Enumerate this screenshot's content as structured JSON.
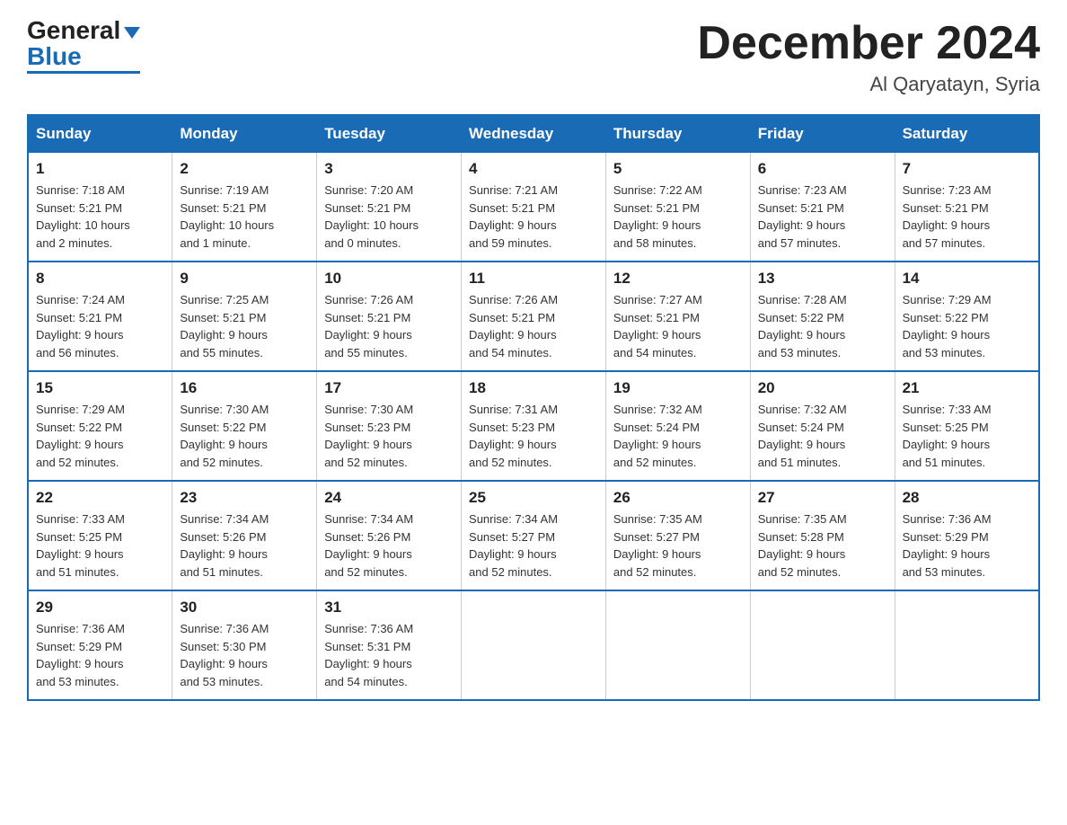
{
  "header": {
    "logo_general": "General",
    "logo_blue": "Blue",
    "month_title": "December 2024",
    "location": "Al Qaryatayn, Syria"
  },
  "weekdays": [
    "Sunday",
    "Monday",
    "Tuesday",
    "Wednesday",
    "Thursday",
    "Friday",
    "Saturday"
  ],
  "weeks": [
    [
      {
        "day": "1",
        "info": "Sunrise: 7:18 AM\nSunset: 5:21 PM\nDaylight: 10 hours\nand 2 minutes."
      },
      {
        "day": "2",
        "info": "Sunrise: 7:19 AM\nSunset: 5:21 PM\nDaylight: 10 hours\nand 1 minute."
      },
      {
        "day": "3",
        "info": "Sunrise: 7:20 AM\nSunset: 5:21 PM\nDaylight: 10 hours\nand 0 minutes."
      },
      {
        "day": "4",
        "info": "Sunrise: 7:21 AM\nSunset: 5:21 PM\nDaylight: 9 hours\nand 59 minutes."
      },
      {
        "day": "5",
        "info": "Sunrise: 7:22 AM\nSunset: 5:21 PM\nDaylight: 9 hours\nand 58 minutes."
      },
      {
        "day": "6",
        "info": "Sunrise: 7:23 AM\nSunset: 5:21 PM\nDaylight: 9 hours\nand 57 minutes."
      },
      {
        "day": "7",
        "info": "Sunrise: 7:23 AM\nSunset: 5:21 PM\nDaylight: 9 hours\nand 57 minutes."
      }
    ],
    [
      {
        "day": "8",
        "info": "Sunrise: 7:24 AM\nSunset: 5:21 PM\nDaylight: 9 hours\nand 56 minutes."
      },
      {
        "day": "9",
        "info": "Sunrise: 7:25 AM\nSunset: 5:21 PM\nDaylight: 9 hours\nand 55 minutes."
      },
      {
        "day": "10",
        "info": "Sunrise: 7:26 AM\nSunset: 5:21 PM\nDaylight: 9 hours\nand 55 minutes."
      },
      {
        "day": "11",
        "info": "Sunrise: 7:26 AM\nSunset: 5:21 PM\nDaylight: 9 hours\nand 54 minutes."
      },
      {
        "day": "12",
        "info": "Sunrise: 7:27 AM\nSunset: 5:21 PM\nDaylight: 9 hours\nand 54 minutes."
      },
      {
        "day": "13",
        "info": "Sunrise: 7:28 AM\nSunset: 5:22 PM\nDaylight: 9 hours\nand 53 minutes."
      },
      {
        "day": "14",
        "info": "Sunrise: 7:29 AM\nSunset: 5:22 PM\nDaylight: 9 hours\nand 53 minutes."
      }
    ],
    [
      {
        "day": "15",
        "info": "Sunrise: 7:29 AM\nSunset: 5:22 PM\nDaylight: 9 hours\nand 52 minutes."
      },
      {
        "day": "16",
        "info": "Sunrise: 7:30 AM\nSunset: 5:22 PM\nDaylight: 9 hours\nand 52 minutes."
      },
      {
        "day": "17",
        "info": "Sunrise: 7:30 AM\nSunset: 5:23 PM\nDaylight: 9 hours\nand 52 minutes."
      },
      {
        "day": "18",
        "info": "Sunrise: 7:31 AM\nSunset: 5:23 PM\nDaylight: 9 hours\nand 52 minutes."
      },
      {
        "day": "19",
        "info": "Sunrise: 7:32 AM\nSunset: 5:24 PM\nDaylight: 9 hours\nand 52 minutes."
      },
      {
        "day": "20",
        "info": "Sunrise: 7:32 AM\nSunset: 5:24 PM\nDaylight: 9 hours\nand 51 minutes."
      },
      {
        "day": "21",
        "info": "Sunrise: 7:33 AM\nSunset: 5:25 PM\nDaylight: 9 hours\nand 51 minutes."
      }
    ],
    [
      {
        "day": "22",
        "info": "Sunrise: 7:33 AM\nSunset: 5:25 PM\nDaylight: 9 hours\nand 51 minutes."
      },
      {
        "day": "23",
        "info": "Sunrise: 7:34 AM\nSunset: 5:26 PM\nDaylight: 9 hours\nand 51 minutes."
      },
      {
        "day": "24",
        "info": "Sunrise: 7:34 AM\nSunset: 5:26 PM\nDaylight: 9 hours\nand 52 minutes."
      },
      {
        "day": "25",
        "info": "Sunrise: 7:34 AM\nSunset: 5:27 PM\nDaylight: 9 hours\nand 52 minutes."
      },
      {
        "day": "26",
        "info": "Sunrise: 7:35 AM\nSunset: 5:27 PM\nDaylight: 9 hours\nand 52 minutes."
      },
      {
        "day": "27",
        "info": "Sunrise: 7:35 AM\nSunset: 5:28 PM\nDaylight: 9 hours\nand 52 minutes."
      },
      {
        "day": "28",
        "info": "Sunrise: 7:36 AM\nSunset: 5:29 PM\nDaylight: 9 hours\nand 53 minutes."
      }
    ],
    [
      {
        "day": "29",
        "info": "Sunrise: 7:36 AM\nSunset: 5:29 PM\nDaylight: 9 hours\nand 53 minutes."
      },
      {
        "day": "30",
        "info": "Sunrise: 7:36 AM\nSunset: 5:30 PM\nDaylight: 9 hours\nand 53 minutes."
      },
      {
        "day": "31",
        "info": "Sunrise: 7:36 AM\nSunset: 5:31 PM\nDaylight: 9 hours\nand 54 minutes."
      },
      {
        "day": "",
        "info": ""
      },
      {
        "day": "",
        "info": ""
      },
      {
        "day": "",
        "info": ""
      },
      {
        "day": "",
        "info": ""
      }
    ]
  ]
}
